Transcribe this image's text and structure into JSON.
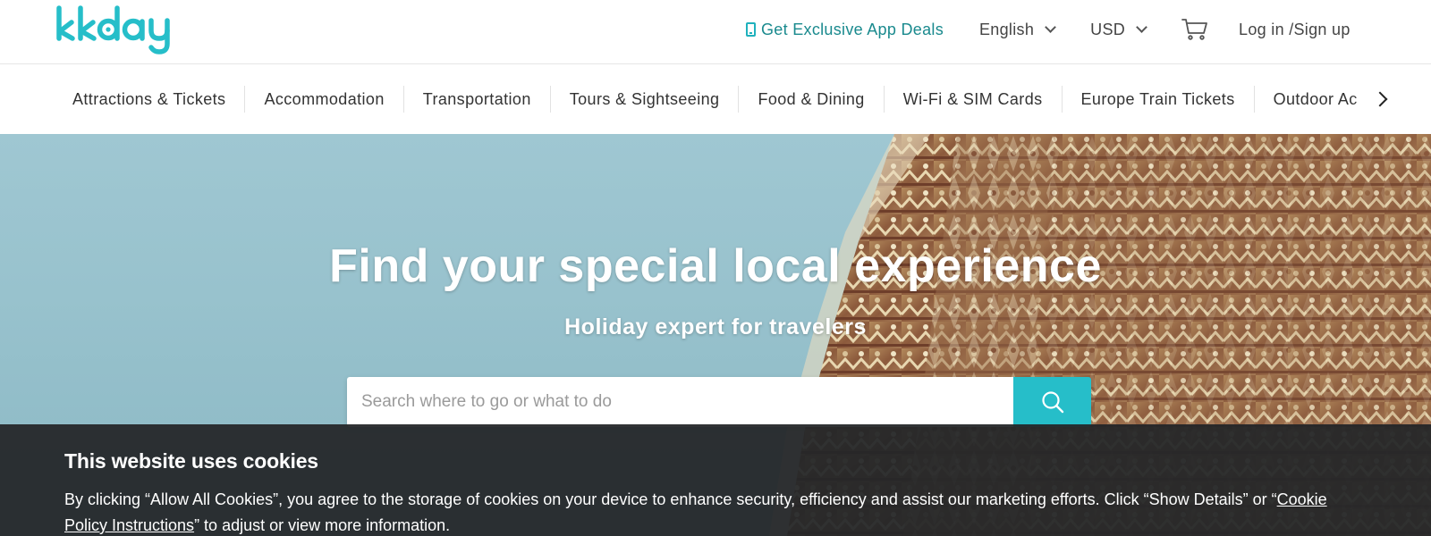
{
  "brand": {
    "logo_text": "kkday",
    "accent_color": "#26bec9"
  },
  "header": {
    "app_deals_label": "Get Exclusive App Deals",
    "app_deals_icon": "mobile-phone-icon",
    "language_label": "English",
    "currency_label": "USD",
    "cart_icon": "shopping-cart-icon",
    "login_label": "Log in /Sign up"
  },
  "categories": [
    "Attractions & Tickets",
    "Accommodation",
    "Transportation",
    "Tours & Sightseeing",
    "Food & Dining",
    "Wi-Fi & SIM Cards",
    "Europe Train Tickets",
    "Outdoor Ac"
  ],
  "hero": {
    "title": "Find your special local experience",
    "subtitle": "Holiday expert for travelers",
    "search_placeholder": "Search where to go or what to do",
    "search_icon": "search-icon"
  },
  "cookie_banner": {
    "title": "This website uses cookies",
    "text_before": "By clicking “Allow All Cookies”, you agree to the storage of cookies on your device to enhance security, efficiency and assist our marketing efforts. Click “Show Details” or “",
    "link_text": "Cookie Policy Instructions",
    "text_after": "” to adjust or view more information."
  }
}
